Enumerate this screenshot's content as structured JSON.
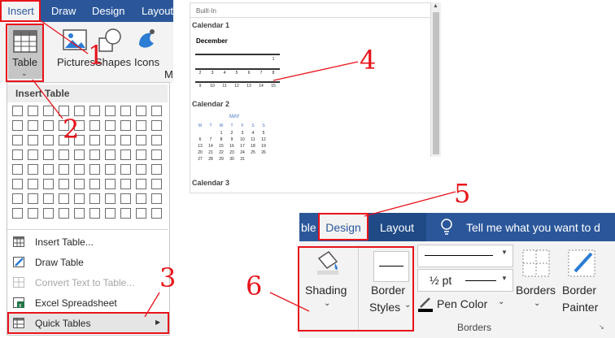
{
  "panel1": {
    "tabs": [
      "Insert",
      "Draw",
      "Design",
      "Layout"
    ],
    "ribbon": {
      "table": "Table",
      "pictures": "Pictures",
      "shapes": "Shapes",
      "icons": "Icons",
      "more": "M"
    },
    "dropdown": {
      "header": "Insert Table",
      "grid": {
        "cols": 10,
        "rows": 8
      },
      "items": [
        "Insert Table...",
        "Draw Table",
        "Convert Text to Table...",
        "Excel Spreadsheet",
        "Quick Tables"
      ],
      "disabled": [
        "Convert Text to Table..."
      ]
    }
  },
  "panel2": {
    "section": "Built-In",
    "calendars": [
      "Calendar 1",
      "Calendar 2",
      "Calendar 3"
    ],
    "calendar1": {
      "month": "December",
      "rows": [
        [
          "",
          "",
          "",
          "",
          "",
          "",
          "1"
        ],
        [
          "2",
          "3",
          "4",
          "5",
          "6",
          "7",
          "8"
        ],
        [
          "9",
          "10",
          "11",
          "12",
          "13",
          "14",
          "15"
        ]
      ]
    },
    "calendar2": {
      "month": "MAY",
      "weekdays": [
        "M",
        "T",
        "W",
        "T",
        "F",
        "S",
        "S"
      ],
      "rows": [
        [
          "",
          "",
          "1",
          "2",
          "3",
          "4",
          "5"
        ],
        [
          "6",
          "7",
          "8",
          "9",
          "10",
          "11",
          "12"
        ],
        [
          "13",
          "14",
          "15",
          "16",
          "17",
          "18",
          "19"
        ],
        [
          "20",
          "21",
          "22",
          "23",
          "24",
          "25",
          "26"
        ],
        [
          "27",
          "28",
          "29",
          "30",
          "31",
          "",
          ""
        ]
      ]
    }
  },
  "panel3": {
    "tabs": {
      "left_partial": "ble",
      "design": "Design",
      "layout": "Layout",
      "tell_me": "Tell me what you want to d"
    },
    "shading": "Shading",
    "border_styles": [
      "Border",
      "Styles"
    ],
    "line_weight": "½ pt",
    "pen_color": "Pen Color",
    "borders": "Borders",
    "border_painter": [
      "Border",
      "Painter"
    ],
    "group_label": "Borders"
  },
  "annotations": {
    "1": "1",
    "2": "2",
    "3": "3",
    "4": "4",
    "5": "5",
    "6": "6"
  },
  "colors": {
    "word_blue": "#2b579a",
    "ribbon_bg": "#f3f3f3",
    "annotation_red": "#e8131b"
  }
}
